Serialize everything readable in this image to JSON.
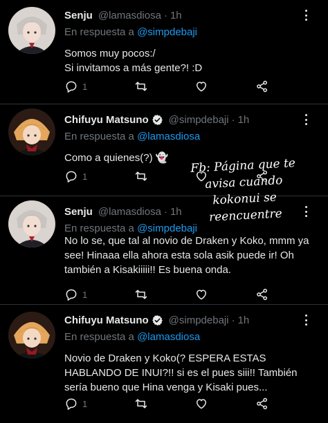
{
  "overlay_text": "Fb: Página que te avisa cuando kokonui se reencuentre",
  "tweets": [
    {
      "name": "Senju",
      "handle": "@lamasdiosa",
      "time": "1h",
      "verified": false,
      "reply_prefix": "En respuesta a",
      "reply_to": "@simpdebaji",
      "text": "Somos muy pocos:/\nSi invitamos a más gente?! :D",
      "reply_count": "1"
    },
    {
      "name": "Chifuyu Matsuno",
      "handle": "@simpdebaji",
      "time": "1h",
      "verified": true,
      "reply_prefix": "En respuesta a",
      "reply_to": "@lamasdiosa",
      "text": "Como a quienes(?) 👻",
      "reply_count": "1"
    },
    {
      "name": "Senju",
      "handle": "@lamasdiosa",
      "time": "1h",
      "verified": false,
      "reply_prefix": "En respuesta a",
      "reply_to": "@simpdebaji",
      "text": "No lo se, que tal al novio de Draken y Koko, mmm ya see! Hinaaa ella ahora esta sola asik puede ir! Oh también a Kisakiiiii!! Es buena onda.",
      "reply_count": "1"
    },
    {
      "name": "Chifuyu Matsuno",
      "handle": "@simpdebaji",
      "time": "1h",
      "verified": true,
      "reply_prefix": "En respuesta a",
      "reply_to": "@lamasdiosa",
      "text": "Novio de Draken y Koko(? ESPERA ESTAS HABLANDO DE INUI?!! si es el pues siii!! También sería bueno que Hina venga y Kisaki pues...",
      "reply_count": "1"
    }
  ],
  "icons": {
    "reply": "reply-icon",
    "retweet": "retweet-icon",
    "like": "heart-icon",
    "share": "share-icon",
    "verified": "verified-badge-icon",
    "more": "more-options-icon"
  },
  "colors": {
    "background": "#000000",
    "text": "#e7e9ea",
    "secondary": "#71767b",
    "link": "#1d9bf0",
    "verified": "#1d9bf0"
  }
}
